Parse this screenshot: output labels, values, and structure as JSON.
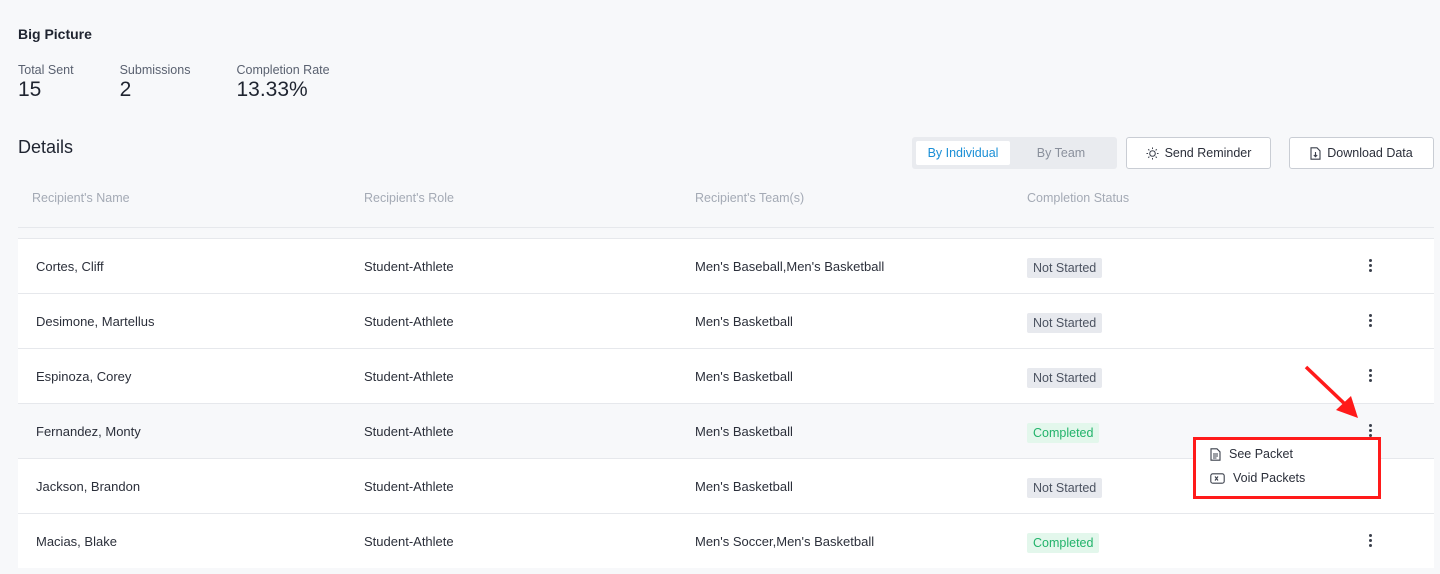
{
  "big_picture": {
    "title": "Big Picture",
    "stats": [
      {
        "label": "Total Sent",
        "value": "15"
      },
      {
        "label": "Submissions",
        "value": "2"
      },
      {
        "label": "Completion Rate",
        "value": "13.33%"
      }
    ]
  },
  "details": {
    "title": "Details",
    "toggle": {
      "individual": "By Individual",
      "team": "By Team",
      "selected": "By Individual"
    },
    "send_reminder": "Send Reminder",
    "download_data": "Download Data"
  },
  "table": {
    "headers": [
      "Recipient's Name",
      "Recipient's Role",
      "Recipient's Team(s)",
      "Completion Status"
    ],
    "rows": [
      {
        "name": "Cortes, Cliff",
        "role": "Student-Athlete",
        "teams": "Men's Baseball,Men's Basketball",
        "status": "Not Started"
      },
      {
        "name": "Desimone, Martellus",
        "role": "Student-Athlete",
        "teams": "Men's Basketball",
        "status": "Not Started"
      },
      {
        "name": "Espinoza, Corey",
        "role": "Student-Athlete",
        "teams": "Men's Basketball",
        "status": "Not Started"
      },
      {
        "name": "Fernandez, Monty",
        "role": "Student-Athlete",
        "teams": "Men's Basketball",
        "status": "Completed"
      },
      {
        "name": "Jackson, Brandon",
        "role": "Student-Athlete",
        "teams": "Men's Basketball",
        "status": "Not Started"
      },
      {
        "name": "Macias, Blake",
        "role": "Student-Athlete",
        "teams": "Men's Soccer,Men's Basketball",
        "status": "Completed"
      }
    ]
  },
  "context_menu": {
    "see_packet": "See Packet",
    "void_packets": "Void Packets"
  },
  "colors": {
    "accent": "#1a8fd6",
    "completed": "#22b36b",
    "highlight": "#ff1a1a"
  }
}
